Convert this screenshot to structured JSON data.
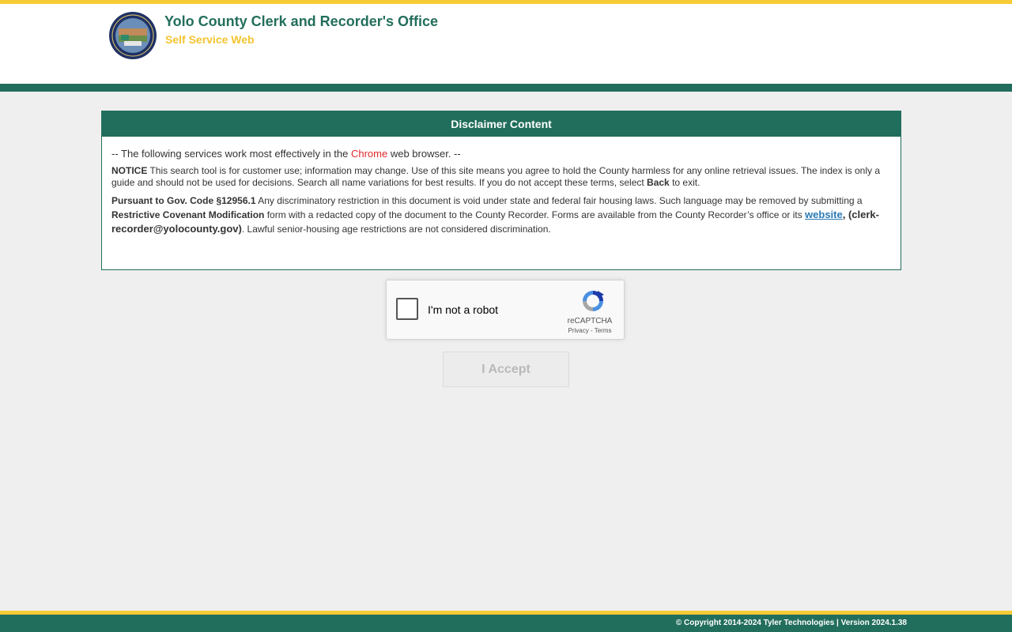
{
  "header": {
    "title": "Yolo County Clerk and Recorder's Office",
    "subtitle": "Self Service Web",
    "seal_icon": "county-seal-icon",
    "colors": {
      "primary": "#226e5c",
      "accent": "#f7cb35"
    }
  },
  "disclaimer": {
    "heading": "Disclaimer Content",
    "browser_prefix": "-- The following services work most effectively in the ",
    "browser_name": "Chrome",
    "browser_suffix": " web browser. --",
    "notice_label": "NOTICE",
    "notice_text": " This search tool is for customer use; information may change. Use of this site means you agree to hold the County harmless for any online retrieval issues. The index is only a guide and should not be used for decisions. Search all name variations for best results. If you do not accept these terms, select ",
    "notice_back": "Back",
    "notice_end": " to exit.",
    "pursuant_label": "Pursuant to Gov. Code §12956.1",
    "pursuant_text": " Any discriminatory restriction in this document is void under state and federal fair housing laws. Such language may be removed by submitting a ",
    "pursuant_form": "Restrictive Covenant Modification",
    "pursuant_text2": " form with a redacted copy of the document to the County Recorder. Forms are available from the County Recorder’s office or its ",
    "website_link": "website",
    "email": ", (clerk-recorder@yolocounty.gov)",
    "pursuant_end": ". Lawful senior-housing age restrictions are not considered discrimination."
  },
  "captcha": {
    "label": "I'm not a robot",
    "brand": "reCAPTCHA",
    "privacy": "Privacy",
    "separator": " - ",
    "terms": "Terms",
    "icon": "recaptcha-logo-icon"
  },
  "accept_button": "I Accept",
  "footer": {
    "copyright": "© Copyright 2014-2024 Tyler Technologies | Version 2024.1.38"
  }
}
